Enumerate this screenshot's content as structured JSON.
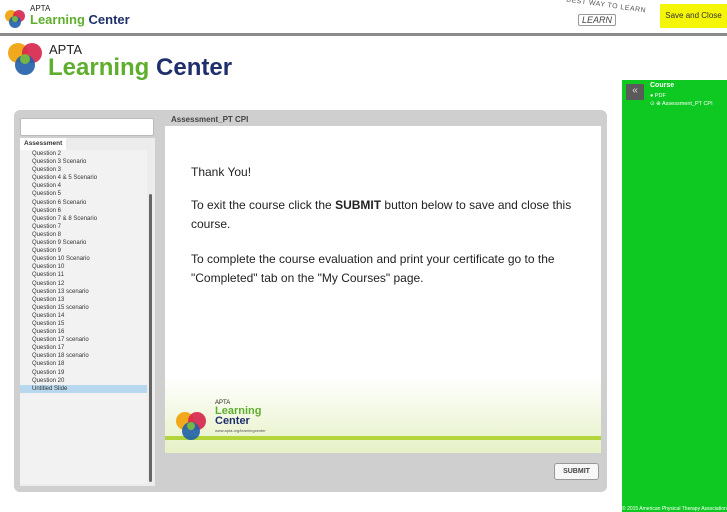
{
  "topbar": {
    "logo_small_line1": "APTA",
    "logo_small_line2_a": "Learning",
    "logo_small_line2_b": " Center",
    "badge_arc": "BEST WAY TO LEARN",
    "badge_learn": "LEARN",
    "save_close_label": "Save and Close"
  },
  "header": {
    "logo_line1": "APTA",
    "logo_line2_a": "Learning",
    "logo_line2_b": " Center"
  },
  "course_panel": {
    "collapse_glyph": "«",
    "title": "Course",
    "items": [
      {
        "bullet": "●",
        "label": "PDF"
      },
      {
        "bullet": "⊙ ⊕",
        "label": "Assessment_PT CPI"
      }
    ],
    "copyright": "© 2015 American Physical Therapy Association"
  },
  "player": {
    "title": "Assessment_PT CPI",
    "toc_tab": "Assessment",
    "toc_items": [
      "Question 2",
      "Question 3 Scenario",
      "Question 3",
      "Question 4 & 5 Scenario",
      "Question 4",
      "Question 5",
      "Question 6 Scenario",
      "Question 6",
      "Question 7 & 8 Scenario",
      "Question 7",
      "Question 8",
      "Question 9 Scenario",
      "Question 9",
      "Question 10 Scenario",
      "Question 10",
      "Question 11",
      "Question 12",
      "Question 13 scenario",
      "Question 13",
      "Question 15 scenario",
      "Question 14",
      "Question 15",
      "Question 16",
      "Question 17 scenario",
      "Question 17",
      "Question 18 scenario",
      "Question 18",
      "Question 19",
      "Question 20",
      "Untitled Slide"
    ],
    "selected_item": "Untitled Slide",
    "slide": {
      "line1": "Thank You!",
      "line2_pre": "To exit the course click the ",
      "line2_bold": "SUBMIT",
      "line2_post": " button below to save and close this course.",
      "line3": "To complete  the course evaluation and print your certificate go to the \"Completed\" tab on the \"My Courses\" page.",
      "logo_line1": "APTA",
      "logo_line2": "Learning",
      "logo_line3": "Center",
      "logo_url": "www.apta.org/learningcenter"
    },
    "submit_label": "SUBMIT"
  }
}
